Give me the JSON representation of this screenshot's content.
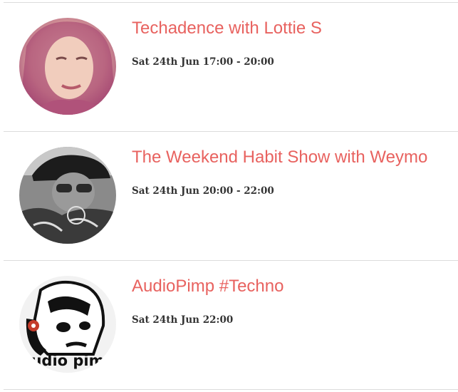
{
  "shows": [
    {
      "title": "Techadence with Lottie S",
      "time": "Sat 24th Jun 17:00 - 20:00",
      "avatar_icon": "woman-portrait",
      "accent": "#e8625f"
    },
    {
      "title": "The Weekend Habit Show with Weymo",
      "time": "Sat 24th Jun 20:00 - 22:00",
      "avatar_icon": "man-with-cap-portrait",
      "accent": "#e8625f"
    },
    {
      "title": "AudioPimp #Techno",
      "time": "Sat 24th Jun 22:00",
      "avatar_icon": "audio-pimp-logo",
      "avatar_text": "udio pim",
      "accent": "#e8625f"
    }
  ]
}
